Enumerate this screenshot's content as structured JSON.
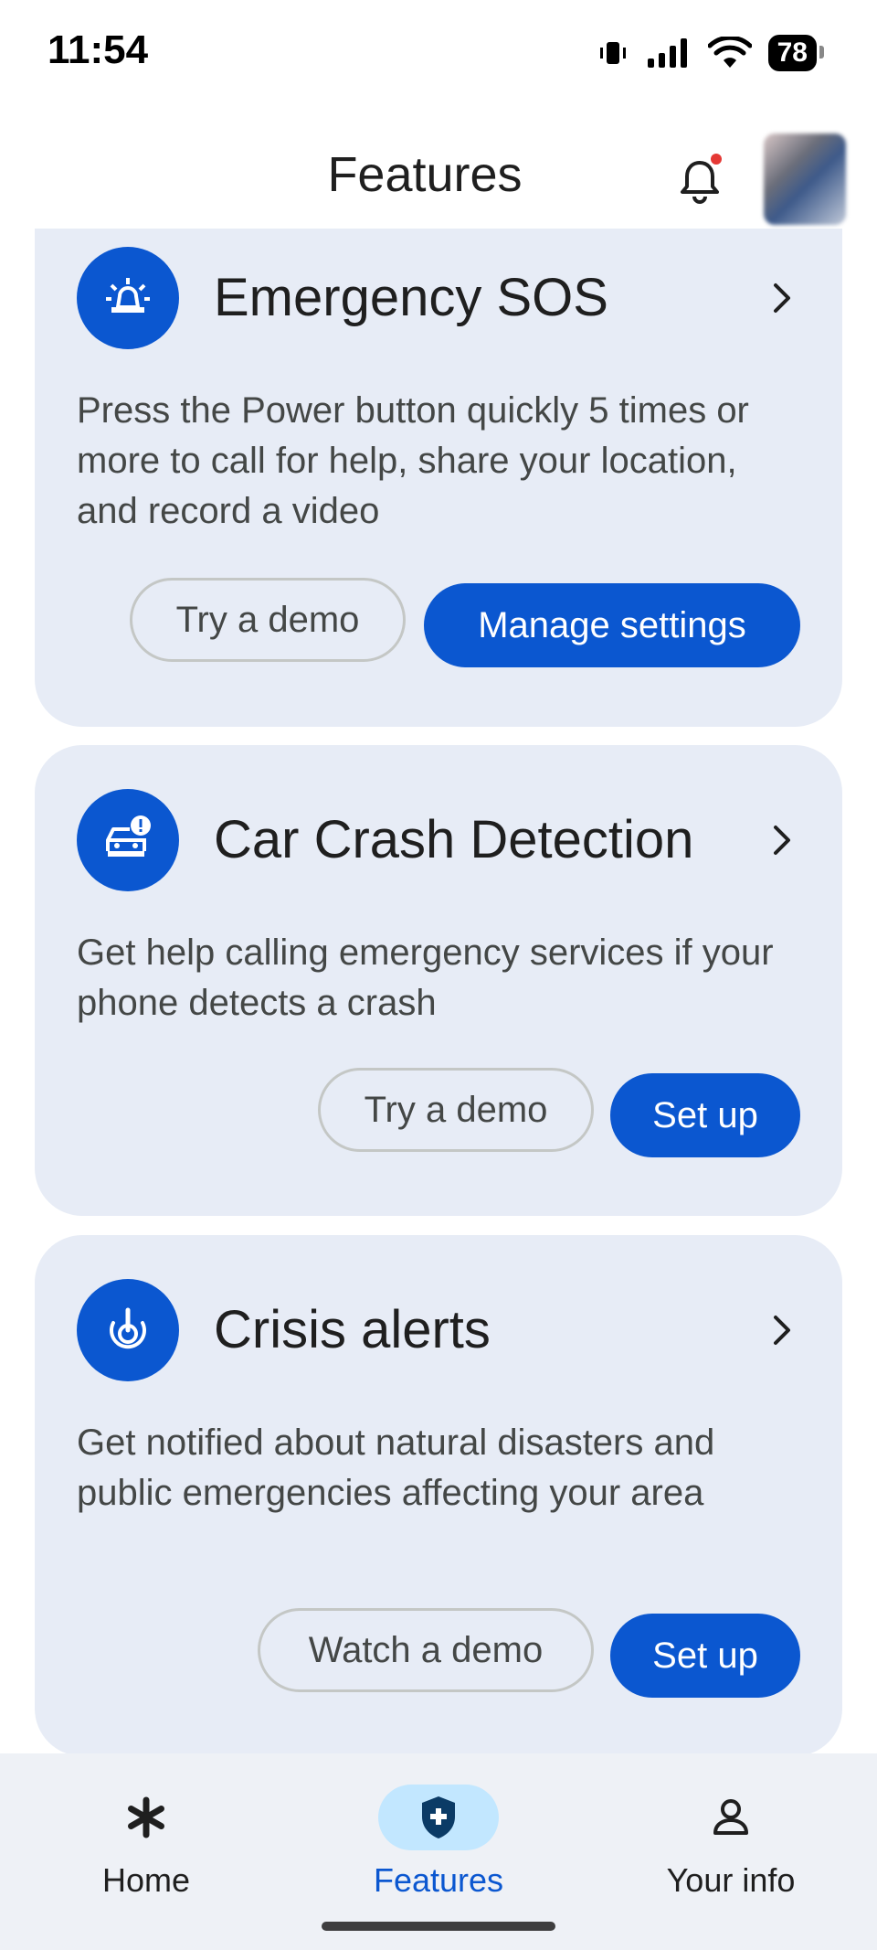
{
  "status_bar": {
    "time": "11:54",
    "battery": "78"
  },
  "header": {
    "title": "Features"
  },
  "cards": [
    {
      "title": "Emergency SOS",
      "description": "Press the Power button quickly 5 times or more to call for help, share your location, and record a video",
      "buttons": {
        "secondary": "Try a demo",
        "primary": "Manage settings"
      },
      "icon": "siren-icon"
    },
    {
      "title": "Car Crash Detection",
      "description": "Get help calling emergency services if your phone detects a crash",
      "buttons": {
        "secondary": "Try a demo",
        "primary": "Set up"
      },
      "icon": "car-crash-icon"
    },
    {
      "title": "Crisis alerts",
      "description": "Get notified about natural disasters and public emergencies affecting your area",
      "buttons": {
        "secondary": "Watch a demo",
        "primary": "Set up"
      },
      "icon": "crisis-alert-icon"
    }
  ],
  "bottom_nav": {
    "items": [
      {
        "label": "Home",
        "icon": "asterisk-icon",
        "active": false
      },
      {
        "label": "Features",
        "icon": "shield-icon",
        "active": true
      },
      {
        "label": "Your info",
        "icon": "person-icon",
        "active": false
      }
    ]
  },
  "colors": {
    "accent": "#0b57d0",
    "card_bg": "#e7ecf6",
    "nav_active_bg": "#c2e7ff",
    "notification_dot": "#e53935"
  }
}
